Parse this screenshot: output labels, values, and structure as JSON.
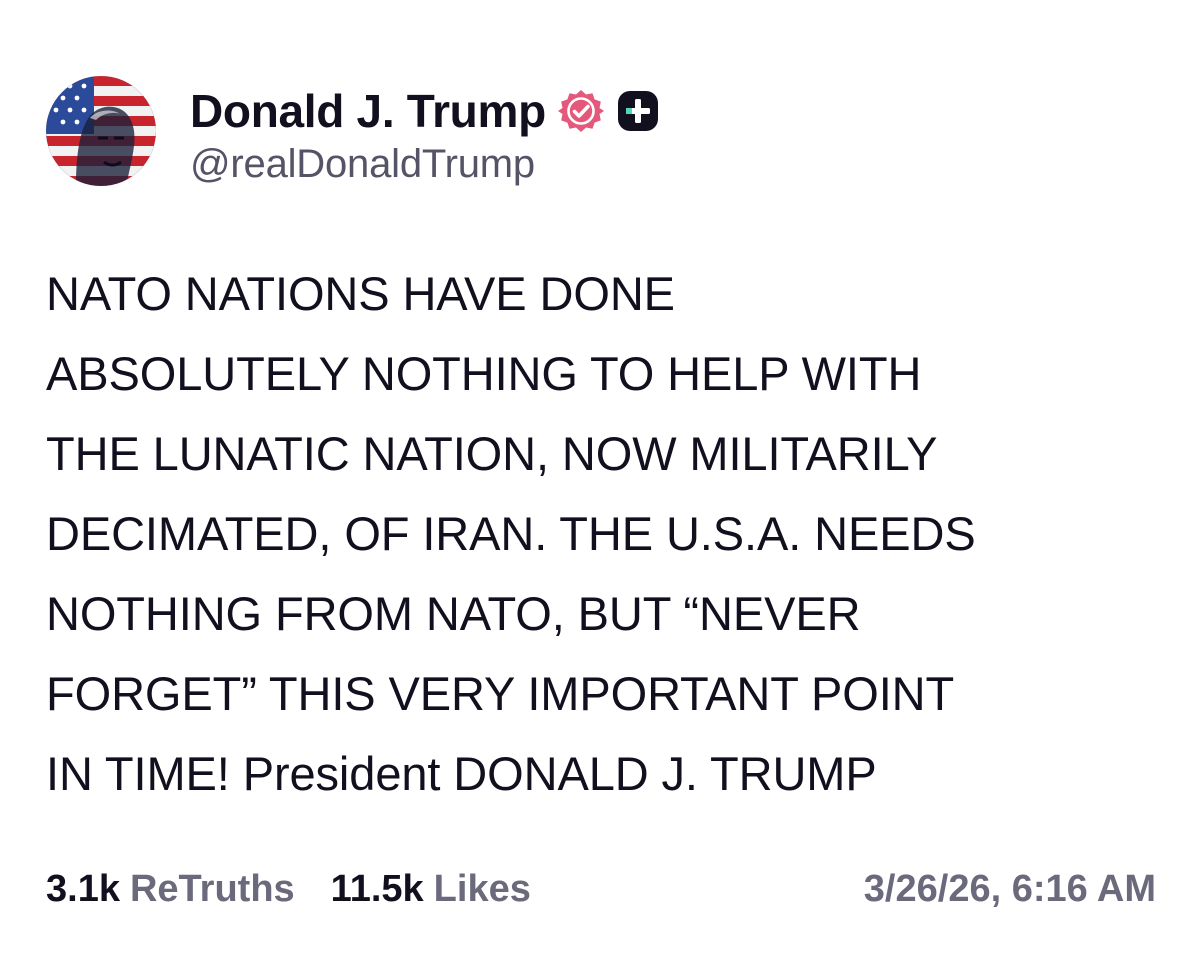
{
  "author": {
    "display_name": "Donald J. Trump",
    "handle": "@realDonaldTrump",
    "avatar_icon": "flag-portrait-avatar",
    "verified_icon": "verified-badge-icon",
    "verified_color": "#e3587b",
    "plus_icon": "truth-plus-badge-icon",
    "plus_bg_color": "#12101f",
    "plus_accent_color": "#4fd8c0"
  },
  "post": {
    "text": "NATO NATIONS HAVE DONE\nABSOLUTELY NOTHING TO HELP WITH\nTHE LUNATIC NATION, NOW MILITARILY\nDECIMATED, OF IRAN. THE U.S.A. NEEDS\nNOTHING FROM NATO, BUT “NEVER\nFORGET” THIS VERY IMPORTANT POINT\nIN TIME! President DONALD J. TRUMP"
  },
  "stats": {
    "retruths_count": "3.1k",
    "retruths_label": "ReTruths",
    "likes_count": "11.5k",
    "likes_label": "Likes",
    "timestamp": "3/26/26, 6:16 AM"
  }
}
